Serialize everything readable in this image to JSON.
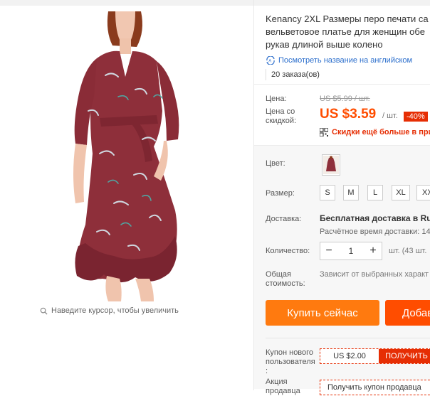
{
  "product": {
    "title_lines": [
      "Kenancy 2XL Размеры перо печати са",
      "вельветовое платье для женщин обе",
      "рукав длиной выше колено"
    ],
    "translate_link": "Посмотреть название на английском",
    "orders": "20 заказа(ов)",
    "zoom_hint": "Наведите курсор, чтобы увеличить"
  },
  "pricing": {
    "price_label": "Цена:",
    "old_price": "US $5.99 / шт.",
    "sale_label_line1": "Цена со",
    "sale_label_line2": "скидкой:",
    "sale_price": "US $3.59",
    "per_unit": "/ шт.",
    "discount": "-40%",
    "more_discount": "Скидки ещё больше в прил"
  },
  "options": {
    "color_label": "Цвет:",
    "size_label": "Размер:",
    "sizes": [
      "S",
      "M",
      "L",
      "XL",
      "XX"
    ]
  },
  "shipping": {
    "label": "Доставка:",
    "main": "Бесплатная доставка в Russi",
    "time": "Расчётное время доставки: 14"
  },
  "quantity": {
    "label": "Количество:",
    "minus": "−",
    "value": "1",
    "plus": "+",
    "stock": "шт. (43 шт."
  },
  "total": {
    "label_line1": "Общая",
    "label_line2": "стоимость:",
    "value": "Зависит от выбранных характ"
  },
  "actions": {
    "buy_now": "Купить сейчас",
    "add_to_cart": "Добав"
  },
  "coupons": {
    "new_user_line1": "Купон нового",
    "new_user_line2": "пользователя",
    "new_user_line3": ":",
    "new_user_amount": "US $2.00",
    "get_button": "ПОЛУЧИТЬ",
    "seller_line1": "Акция",
    "seller_line2": "продавца",
    "seller_coupon": "Получить купон продавца"
  },
  "colors": {
    "price": "#ff4d00",
    "discount_bg": "#e62e04",
    "buy_button": "#ff7a0f",
    "cart_button": "#ff4d00",
    "link": "#2b6ecc",
    "dress": "#8e2f3a"
  }
}
